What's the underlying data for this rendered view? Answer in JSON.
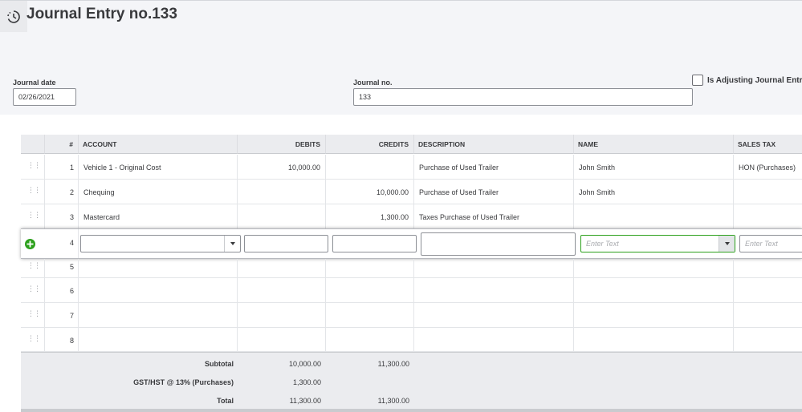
{
  "page": {
    "title": "Journal Entry no.133"
  },
  "form": {
    "journal_date_label": "Journal date",
    "journal_date_value": "02/26/2021",
    "journal_no_label": "Journal no.",
    "journal_no_value": "133",
    "adjusting_label": "Is Adjusting Journal Entry?",
    "adjusting_checked": false
  },
  "table": {
    "headers": {
      "num": "#",
      "account": "ACCOUNT",
      "debits": "DEBITS",
      "credits": "CREDITS",
      "description": "DESCRIPTION",
      "name": "NAME",
      "sales_tax": "SALES TAX"
    },
    "rows": [
      {
        "num": "1",
        "account": "Vehicle 1 - Original Cost",
        "debits": "10,000.00",
        "credits": "",
        "description": "Purchase of Used Trailer",
        "name": "John Smith",
        "sales_tax": "HON (Purchases)"
      },
      {
        "num": "2",
        "account": "Chequing",
        "debits": "",
        "credits": "10,000.00",
        "description": "Purchase of Used Trailer",
        "name": "John Smith",
        "sales_tax": ""
      },
      {
        "num": "3",
        "account": "Mastercard",
        "debits": "",
        "credits": "1,300.00",
        "description": "Taxes Purchase of Used Trailer",
        "name": "",
        "sales_tax": ""
      }
    ],
    "active_row": {
      "num": "4",
      "name_placeholder": "Enter Text",
      "sales_tax_placeholder": "Enter Text"
    },
    "empty_rows": [
      "5",
      "6",
      "7",
      "8"
    ]
  },
  "totals": {
    "subtotal_label": "Subtotal",
    "subtotal_debits": "10,000.00",
    "subtotal_credits": "11,300.00",
    "tax_label": "GST/HST @ 13% (Purchases)",
    "tax_debits": "1,300.00",
    "total_label": "Total",
    "total_debits": "11,300.00",
    "total_credits": "11,300.00"
  },
  "colors": {
    "accent_green": "#2ca01c",
    "header_bg": "#f4f5f8"
  },
  "icons": {
    "history": "history-clock-icon",
    "add_line": "plus-circle-icon",
    "drag": "drag-handle-icon",
    "dropdown": "chevron-down-icon"
  }
}
